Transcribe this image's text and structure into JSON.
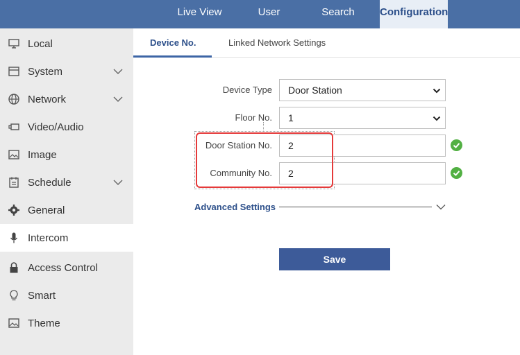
{
  "topnav": {
    "items": [
      {
        "label": "Live View"
      },
      {
        "label": "User"
      },
      {
        "label": "Search"
      },
      {
        "label": "Configuration"
      }
    ],
    "active": "Configuration"
  },
  "sidebar": {
    "items": [
      {
        "label": "Local",
        "icon": "monitor-icon"
      },
      {
        "label": "System",
        "icon": "system-icon",
        "expandable": true
      },
      {
        "label": "Network",
        "icon": "globe-icon",
        "expandable": true
      },
      {
        "label": "Video/Audio",
        "icon": "camera-icon"
      },
      {
        "label": "Image",
        "icon": "image-icon"
      },
      {
        "label": "Schedule",
        "icon": "calendar-icon",
        "expandable": true
      },
      {
        "label": "General",
        "icon": "gear-icon"
      },
      {
        "label": "Intercom",
        "icon": "microphone-icon"
      },
      {
        "label": "Access Control",
        "icon": "lock-icon"
      },
      {
        "label": "Smart",
        "icon": "lightbulb-icon"
      },
      {
        "label": "Theme",
        "icon": "image-icon"
      }
    ],
    "active": "Intercom"
  },
  "tabs": {
    "items": [
      {
        "label": "Device No."
      },
      {
        "label": "Linked Network Settings"
      }
    ],
    "active": "Device No."
  },
  "form": {
    "device_type": {
      "label": "Device Type",
      "value": "Door Station"
    },
    "floor_no": {
      "label": "Floor No.",
      "value": "1"
    },
    "door_station_no": {
      "label": "Door Station No.",
      "value": "2",
      "valid": true
    },
    "community_no": {
      "label": "Community No.",
      "value": "2",
      "valid": true
    },
    "advanced_settings": "Advanced Settings",
    "save_label": "Save"
  },
  "colors": {
    "topbar": "#4a6fa5",
    "accent": "#2c4f8a",
    "save_button": "#3d5b99",
    "highlight": "#e53a3a",
    "valid": "#52b043"
  }
}
